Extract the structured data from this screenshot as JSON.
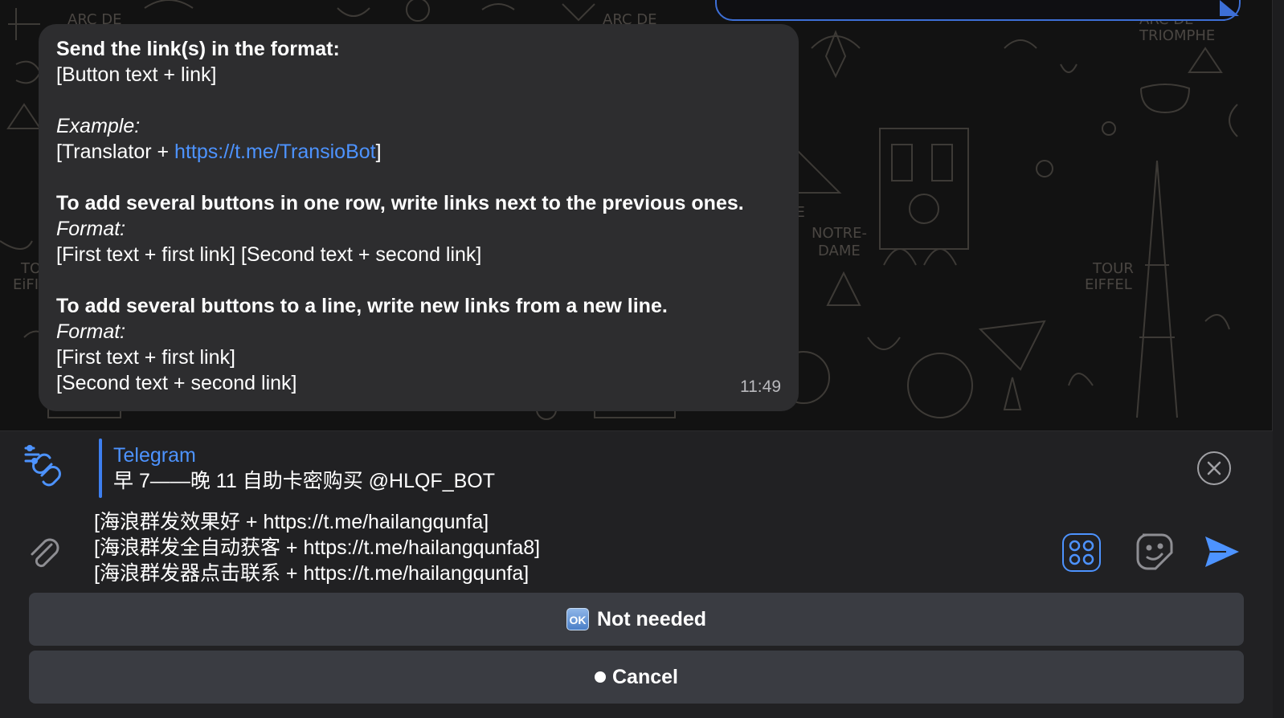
{
  "message": {
    "lines": [
      {
        "text": "Send the link(s) in the format:",
        "style": "bold"
      },
      {
        "text": "[Button text + link]",
        "style": "normal"
      },
      {
        "text": "",
        "style": "gap"
      },
      {
        "text": "Example:",
        "style": "italic"
      },
      {
        "prefix": "[Translator + ",
        "link": "https://t.me/TransioBot",
        "suffix": "]",
        "style": "link-line"
      },
      {
        "text": "",
        "style": "gap"
      },
      {
        "text": "To add several buttons in one row, write links next to the previous ones.",
        "style": "bold"
      },
      {
        "text": "Format:",
        "style": "italic"
      },
      {
        "text": "[First text + first link] [Second text + second link]",
        "style": "normal"
      },
      {
        "text": "",
        "style": "gap"
      },
      {
        "text": "To add several buttons to a line, write new links from a new line.",
        "style": "bold"
      },
      {
        "text": "Format:",
        "style": "italic"
      },
      {
        "text": "[First text + first link]",
        "style": "normal"
      },
      {
        "text": "[Second text + second link]",
        "style": "normal"
      }
    ],
    "time": "11:49"
  },
  "reply": {
    "title": "Telegram",
    "text": "早 7——晚 11 自助卡密购买 @HLQF_BOT",
    "icon": "link-settings-icon"
  },
  "input": {
    "lines": [
      "[海浪群发效果好 + https://t.me/hailangqunfa]",
      "[海浪群发全自动获客 + https://t.me/hailangqunfa8]",
      "[海浪群发器点击联系  + https://t.me/hailangqunfa]"
    ]
  },
  "keyboard": {
    "buttons": [
      {
        "badge": "OK",
        "label": "Not needed"
      },
      {
        "label": "Cancel"
      }
    ]
  },
  "colors": {
    "accent": "#4d93ff",
    "bubble": "#2d2d2f",
    "panel": "#212123",
    "keyboard_button": "#3a3c42"
  }
}
